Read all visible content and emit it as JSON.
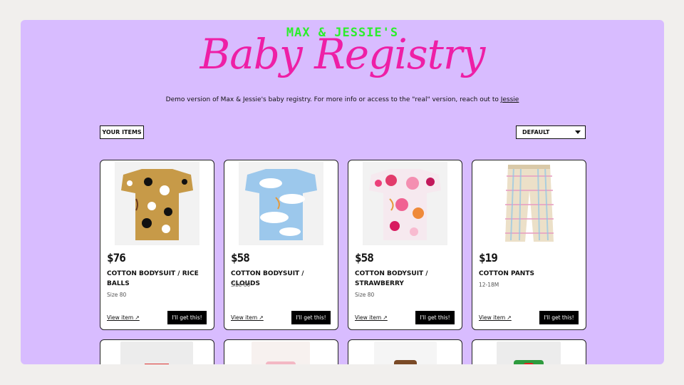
{
  "header": {
    "kicker": "MAX & JESSIE'S",
    "title": "Baby Registry"
  },
  "intro": {
    "text": "Demo version of Max & Jessie's baby registry. For more info or access to the \"real\" version, reach out to ",
    "link": "Jessie"
  },
  "filters": {
    "your_items": "YOUR ITEMS",
    "sort_value": "DEFAULT"
  },
  "items": [
    {
      "price": "$76",
      "title": "COTTON BODYSUIT / RICE BALLS",
      "size": "Size 80",
      "view": "View item ↗",
      "cta": "I'll get this!"
    },
    {
      "price": "$58",
      "title": "COTTON BODYSUIT / CLOUDS",
      "size": "Size 80",
      "view": "View item ↗",
      "cta": "I'll get this!"
    },
    {
      "price": "$58",
      "title": "COTTON BODYSUIT / STRAWBERRY",
      "size": "Size 80",
      "view": "View item ↗",
      "cta": "I'll get this!"
    },
    {
      "price": "$19",
      "title": "COTTON PANTS",
      "size": "12-18M",
      "view": "View item ↗",
      "cta": "I'll get this!"
    }
  ],
  "colors": {
    "background": "#d8bcff",
    "accent_pink": "#ee1fa6",
    "accent_green": "#2bee2b"
  }
}
